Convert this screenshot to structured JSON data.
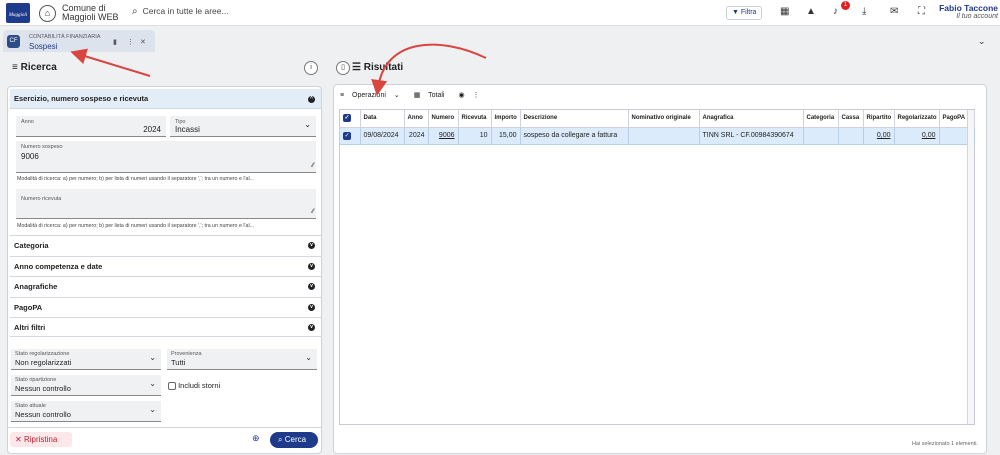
{
  "topbar": {
    "logo_text": "Maggioli",
    "app_line1": "Comune di",
    "app_line2": "Maggioli WEB",
    "search_placeholder": "Cerca in tutte le aree...",
    "filter_label": "Filtra",
    "notification_count": "1",
    "user_name": "Fabio Taccone",
    "user_role": "Il tuo account"
  },
  "tab": {
    "icon_text": "CF",
    "category": "CONTABILITÀ FINANZIARIA",
    "title": "Sospesi"
  },
  "left": {
    "title": "Ricerca",
    "section_open": "Esercizio, numero sospeso e ricevuta",
    "anno_label": "Anno",
    "anno_value": "2024",
    "tipo_label": "Tipo",
    "tipo_value": "Incassi",
    "num_sospeso_label": "Numero sospeso",
    "num_sospeso_value": "9006",
    "hint1": "Modalità di ricerca: a) per numero; b) per lista di numeri usando il separatore ','; tra un numero e l'al...",
    "num_ricevuta_label": "Numero ricevuta",
    "hint2": "Modalità di ricerca: a) per numero; b) per lista di numeri usando il separatore ','; tra un numero e l'al...",
    "sections": [
      "Categoria",
      "Anno competenza e date",
      "Anagrafiche",
      "PagoPA",
      "Altri filtri"
    ],
    "stato_reg_label": "Stato regolarizzazione",
    "stato_reg_value": "Non regolarizzati",
    "provenienza_label": "Provenienza",
    "provenienza_value": "Tutti",
    "stato_rip_label": "Stato ripartizione",
    "stato_rip_value": "Nessun controllo",
    "includi_storni": "Includi storni",
    "stato_att_label": "Stato attuale",
    "stato_att_value": "Nessun controllo",
    "reset_label": "Ripristina",
    "search_label": "Cerca"
  },
  "right": {
    "title": "Risultati",
    "operazioni": "Operazioni",
    "totali": "Totali",
    "columns": [
      "",
      "Data",
      "Anno",
      "Numero",
      "Ricevuta",
      "Importo",
      "Descrizione",
      "Nominativo originale",
      "Anagrafica",
      "Categoria",
      "Cassa",
      "Ripartito",
      "Regolarizzato",
      "PagoPA"
    ],
    "rows": [
      [
        "",
        "09/08/2024",
        "2024",
        "9006",
        "10",
        "15,00",
        "sospeso da collegare a fattura",
        "",
        "TINN SRL - CF.00984390674",
        "",
        "",
        "0,00",
        "0,00",
        ""
      ]
    ],
    "footer": "Hai selezionato 1 elementi."
  },
  "colors": {
    "accent": "#1e3a8a",
    "annotation": "#d9453f",
    "selected_row": "#dcebfb"
  }
}
